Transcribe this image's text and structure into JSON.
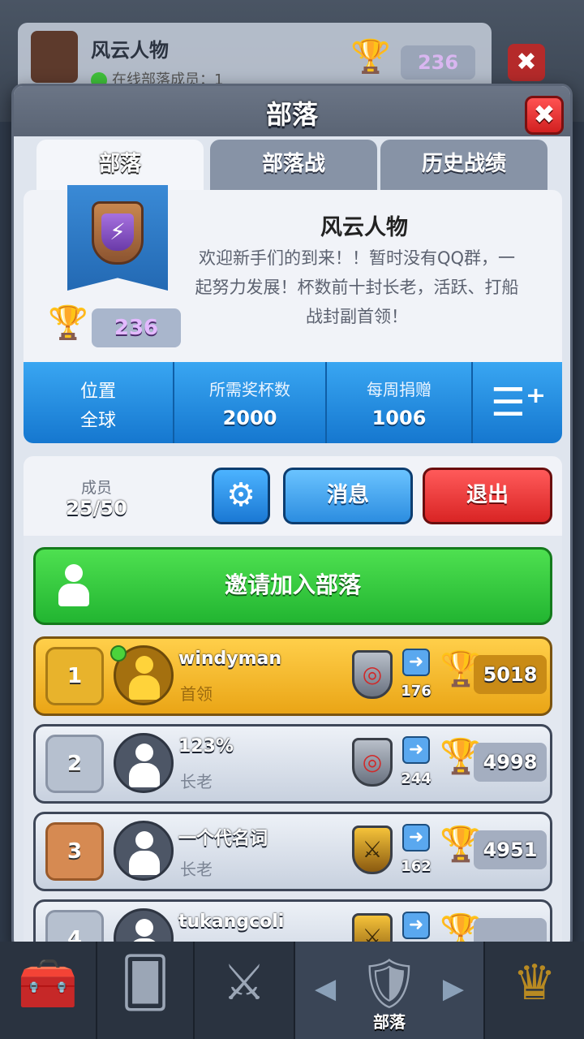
{
  "background": {
    "clan_name": "风云人物",
    "online_text": "在线部落成员：1",
    "trophies": "236",
    "close": "✖"
  },
  "panel": {
    "title": "部落",
    "close": "✖",
    "tabs": [
      {
        "label": "部落"
      },
      {
        "label": "部落战"
      },
      {
        "label": "历史战绩"
      }
    ]
  },
  "clan": {
    "name": "风云人物",
    "description": "欢迎新手们的到来！！暂时没有QQ群，一起努力发展！杯数前十封长老，活跃、打船战封副首领！",
    "trophies": "236",
    "badge_icon": "lightning-icon",
    "stats": {
      "location_label": "位置",
      "location_value": "全球",
      "required_label": "所需奖杯数",
      "required_value": "2000",
      "donations_label": "每周捐赠",
      "donations_value": "1006"
    }
  },
  "members": {
    "label": "成员",
    "count": "25/50",
    "message_label": "消息",
    "exit_label": "退出",
    "invite_label": "邀请加入部落",
    "list": [
      {
        "rank": "1",
        "name": "windyman",
        "role": "首领",
        "donations": "176",
        "trophies": "5018"
      },
      {
        "rank": "2",
        "name": "123%",
        "role": "长老",
        "donations": "244",
        "trophies": "4998"
      },
      {
        "rank": "3",
        "name": "一个代名词",
        "role": "长老",
        "donations": "162",
        "trophies": "4951"
      },
      {
        "rank": "4",
        "name": "tukangcoli",
        "role": "",
        "donations": "",
        "trophies": ""
      }
    ]
  },
  "nav": {
    "clan_label": "部落"
  },
  "colors": {
    "accent_blue": "#1f88e0",
    "exit_red": "#e03030",
    "invite_green": "#2fc23a",
    "leader_gold": "#f3b829"
  }
}
